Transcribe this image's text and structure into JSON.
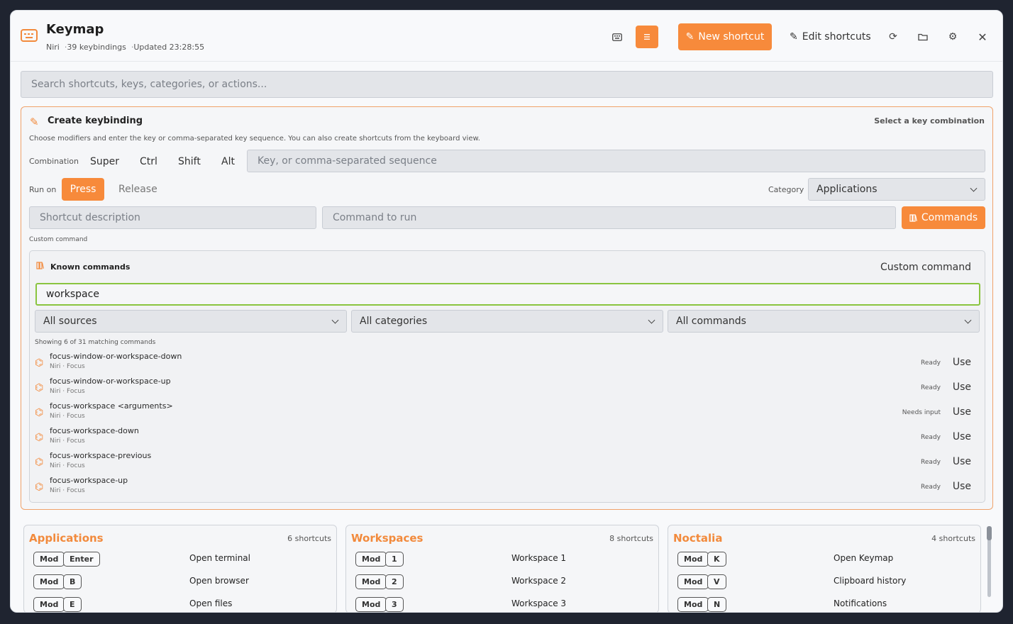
{
  "header": {
    "title": "Keymap",
    "subtitle_compositor": "Niri",
    "subtitle_count": "39 keybindings",
    "subtitle_updated": "Updated 23:28:55",
    "new_shortcut_label": "New shortcut",
    "edit_shortcuts_label": "Edit shortcuts",
    "accent_color": "#f78a3b"
  },
  "search": {
    "placeholder": "Search shortcuts, keys, categories, or actions..."
  },
  "create": {
    "title": "Create keybinding",
    "hint": "Select a key combination",
    "description": "Choose modifiers and enter the key or comma-separated key sequence. You can also create shortcuts from the keyboard view.",
    "combination_label": "Combination",
    "modifiers": [
      "Super",
      "Ctrl",
      "Shift",
      "Alt"
    ],
    "key_placeholder": "Key, or comma-separated sequence",
    "run_on_label": "Run on",
    "press_label": "Press",
    "release_label": "Release",
    "category_label": "Category",
    "category_value": "Applications",
    "desc_placeholder": "Shortcut description",
    "command_placeholder": "Command to run",
    "commands_button": "Commands",
    "custom_command_label": "Custom command"
  },
  "known": {
    "title": "Known commands",
    "custom_command": "Custom command",
    "search_value": "workspace",
    "source_filter": "All sources",
    "category_filter": "All categories",
    "command_filter": "All commands",
    "matching_text": "Showing 6 of 31 matching commands",
    "use_label": "Use",
    "commands": [
      {
        "name": "focus-window-or-workspace-down",
        "meta": "Niri · Focus",
        "status": "Ready"
      },
      {
        "name": "focus-window-or-workspace-up",
        "meta": "Niri · Focus",
        "status": "Ready"
      },
      {
        "name": "focus-workspace <arguments>",
        "meta": "Niri · Focus",
        "status": "Needs input"
      },
      {
        "name": "focus-workspace-down",
        "meta": "Niri · Focus",
        "status": "Ready"
      },
      {
        "name": "focus-workspace-previous",
        "meta": "Niri · Focus",
        "status": "Ready"
      },
      {
        "name": "focus-workspace-up",
        "meta": "Niri · Focus",
        "status": "Ready"
      }
    ]
  },
  "categories": [
    {
      "name": "Applications",
      "count": "6 shortcuts",
      "bindings": [
        {
          "keys": [
            "Mod",
            "Enter"
          ],
          "label": "Open terminal"
        },
        {
          "keys": [
            "Mod",
            "B"
          ],
          "label": "Open browser"
        },
        {
          "keys": [
            "Mod",
            "E"
          ],
          "label": "Open files"
        }
      ]
    },
    {
      "name": "Workspaces",
      "count": "8 shortcuts",
      "bindings": [
        {
          "keys": [
            "Mod",
            "1"
          ],
          "label": "Workspace 1"
        },
        {
          "keys": [
            "Mod",
            "2"
          ],
          "label": "Workspace 2"
        },
        {
          "keys": [
            "Mod",
            "3"
          ],
          "label": "Workspace 3"
        }
      ]
    },
    {
      "name": "Noctalia",
      "count": "4 shortcuts",
      "bindings": [
        {
          "keys": [
            "Mod",
            "K"
          ],
          "label": "Open Keymap"
        },
        {
          "keys": [
            "Mod",
            "V"
          ],
          "label": "Clipboard history"
        },
        {
          "keys": [
            "Mod",
            "N"
          ],
          "label": "Notifications"
        }
      ]
    }
  ]
}
